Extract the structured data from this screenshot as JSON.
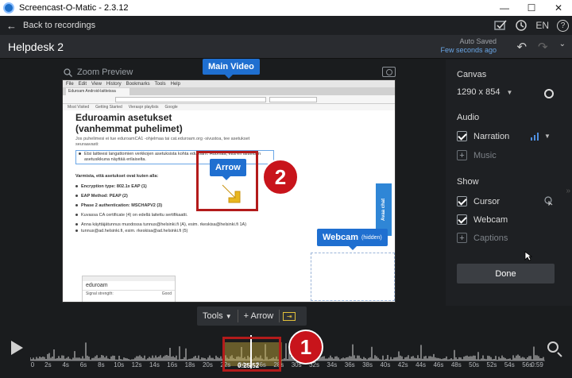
{
  "window": {
    "title": "Screencast-O-Matic - 2.3.12",
    "minimize": "—",
    "maximize": "☐",
    "close": "✕"
  },
  "nav": {
    "back_label": "Back to recordings",
    "lang": "EN",
    "help": "?"
  },
  "project": {
    "name": "Helpdesk 2",
    "autosave_title": "Auto Saved",
    "autosave_time": "Few seconds ago"
  },
  "editor": {
    "zoom_preview_label": "Zoom Preview",
    "main_video_tag": "Main Video",
    "arrow_tag": "Arrow",
    "webcam_tag": "Webcam",
    "webcam_hidden": "(hidden)"
  },
  "browser": {
    "menu": [
      "File",
      "Edit",
      "View",
      "History",
      "Bookmarks",
      "Tools",
      "Help"
    ],
    "tab": "Eduroam Android-laitteissa",
    "bookmarks": [
      "Most Visited",
      "Getting Started",
      "Vieraspr playlists",
      "Google"
    ]
  },
  "article": {
    "title": "Eduroamin asetukset (vanhemmat puhelimet)",
    "intro": "Jos puhelimesi ei tue eduroamCA1 -ohjelmaa tai cat.eduroam.org -sivustoa, tee asetukset seuraavasti:",
    "step": "Etsi laitteesi langattomien verkkojen asetuksista kohta eduroam. Huomaa, että eri laitteiden asetusikkuna näyttää erilaiselta.",
    "check": "Varmista, että asetukset ovat kuten alla:",
    "settings": [
      "Encryption type: 802.1x EAP (1)",
      "EAP Method: PEAP (2)",
      "Phase 2 authentication: MSCHAPV2 (3)",
      "Kuvassa CA certificate (4) on edellä laitettu sertifikaatti.",
      "Anna käyttäjätunnus muodossa tunnus@helsinki.fi (A), esim. rkeskisa@helsinki.fi 1A)",
      "tunnus@ad.helsinki.fi, esim. rkeskisa@ad.helsinki.fi (5)"
    ],
    "phone_title": "eduroam",
    "phone_signal": "Signal strength:",
    "phone_signal_val": "Good",
    "chat": "Avaa chat"
  },
  "markers": {
    "one": "1",
    "two": "2"
  },
  "panel": {
    "canvas_title": "Canvas",
    "canvas_size": "1290 x 854",
    "audio_title": "Audio",
    "narration": "Narration",
    "music": "Music",
    "show_title": "Show",
    "cursor": "Cursor",
    "webcam": "Webcam",
    "captions": "Captions",
    "done": "Done"
  },
  "tools": {
    "tools_label": "Tools",
    "add_label": "+ Arrow"
  },
  "timeline": {
    "timecode": "0:25.52",
    "ticks": [
      "0",
      "2s",
      "4s",
      "6s",
      "8s",
      "10s",
      "12s",
      "14s",
      "16s",
      "18s",
      "20s",
      "22s",
      "24s",
      "26s",
      "28s",
      "30s",
      "32s",
      "34s",
      "36s",
      "38s",
      "40s",
      "42s",
      "44s",
      "46s",
      "48s",
      "50s",
      "52s",
      "54s",
      "56s",
      "0:59"
    ]
  },
  "colors": {
    "accent": "#1f6fd0",
    "marker": "#c8141b",
    "autosave_time": "#6aa6e6"
  }
}
